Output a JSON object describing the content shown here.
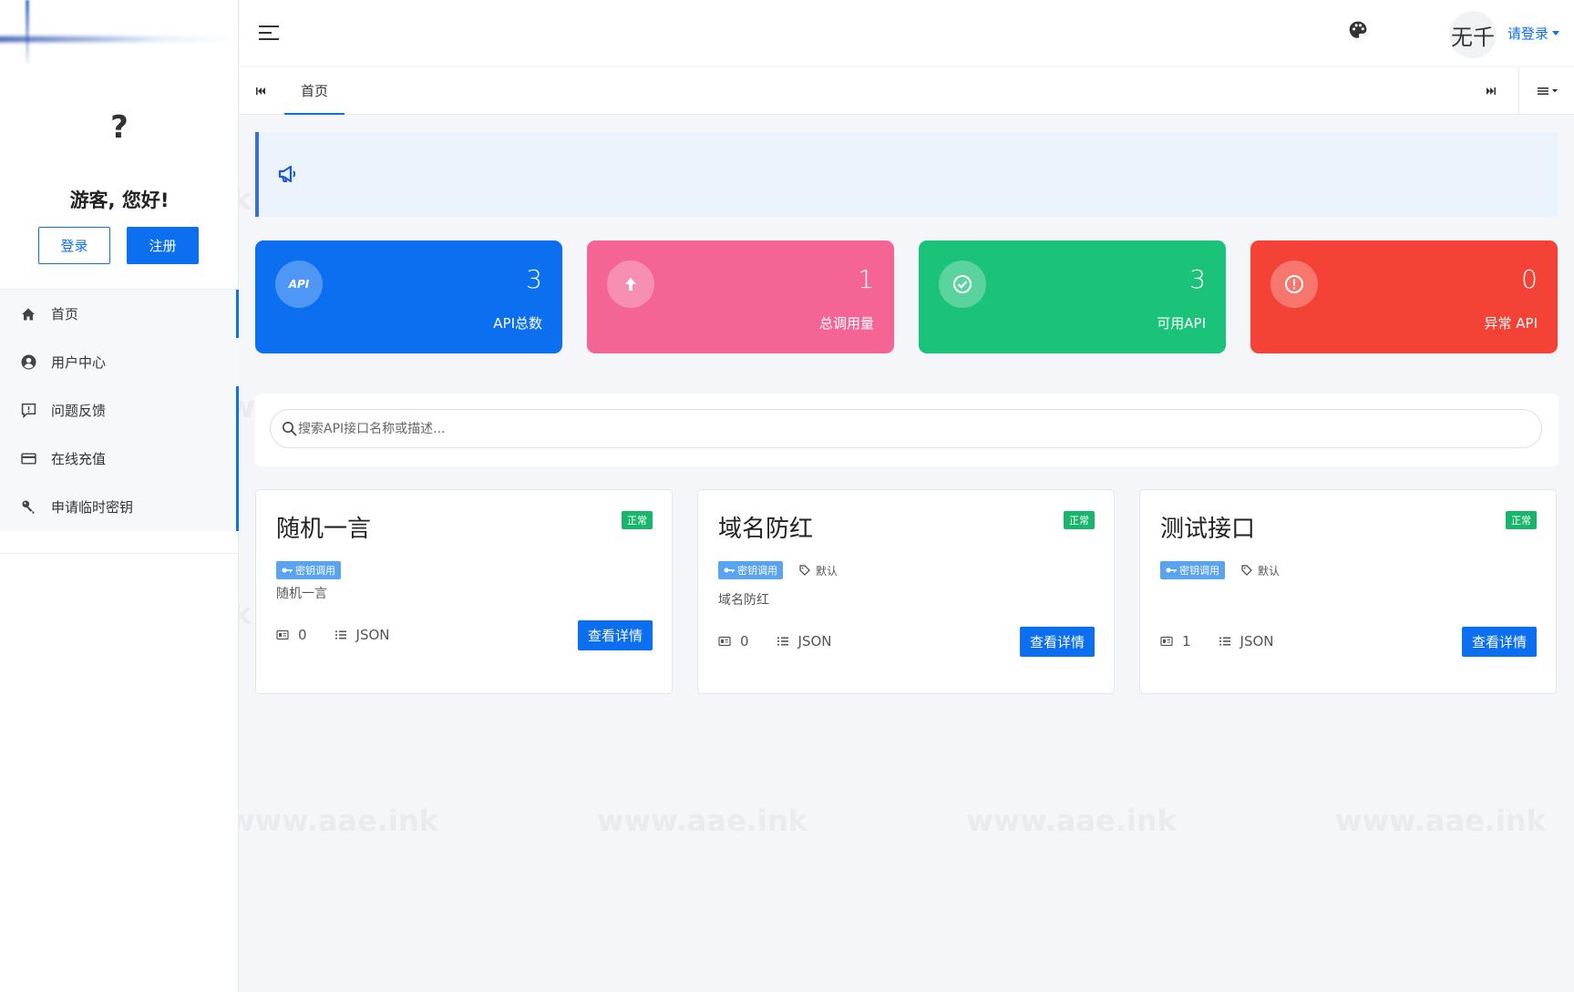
{
  "sidebar": {
    "avatar_placeholder": "?",
    "greeting": "游客, 您好!",
    "login_label": "登录",
    "register_label": "注册",
    "nav": [
      {
        "label": "首页",
        "icon": "home-icon"
      },
      {
        "label": "用户中心",
        "icon": "user-circle-icon"
      },
      {
        "label": "问题反馈",
        "icon": "feedback-icon"
      },
      {
        "label": "在线充值",
        "icon": "credit-card-icon"
      },
      {
        "label": "申请临时密钥",
        "icon": "key-icon"
      }
    ]
  },
  "topbar": {
    "avatar_text": "无千",
    "user_login_label": "请登录"
  },
  "tabs": {
    "items": [
      {
        "label": "首页",
        "active": true
      }
    ]
  },
  "stats": [
    {
      "value": "3",
      "label": "API总数",
      "icon_text": "API",
      "color": "#0b6ff0"
    },
    {
      "value": "1",
      "label": "总调用量",
      "icon": "arrow-up-icon",
      "color": "#f46595"
    },
    {
      "value": "3",
      "label": "可用API",
      "icon": "check-circle-icon",
      "color": "#1bc27a"
    },
    {
      "value": "0",
      "label": "异常 API",
      "icon": "alert-circle-icon",
      "color": "#f44336"
    }
  ],
  "search": {
    "placeholder": "搜索API接口名称或描述..."
  },
  "cards": [
    {
      "title": "随机一言",
      "status": "正常",
      "auth_tag": "密钥调用",
      "category": "",
      "desc": "随机一言",
      "calls": "0",
      "format": "JSON",
      "button": "查看详情"
    },
    {
      "title": "域名防红",
      "status": "正常",
      "auth_tag": "密钥调用",
      "category": "默认",
      "desc": "域名防红",
      "calls": "0",
      "format": "JSON",
      "button": "查看详情"
    },
    {
      "title": "测试接口",
      "status": "正常",
      "auth_tag": "密钥调用",
      "category": "默认",
      "desc": "",
      "calls": "1",
      "format": "JSON",
      "button": "查看详情"
    }
  ],
  "watermark": "www.aae.ink",
  "colors": {
    "primary": "#0b6ff0",
    "success": "#19b56a",
    "notice_bg": "#ebf3fd"
  }
}
